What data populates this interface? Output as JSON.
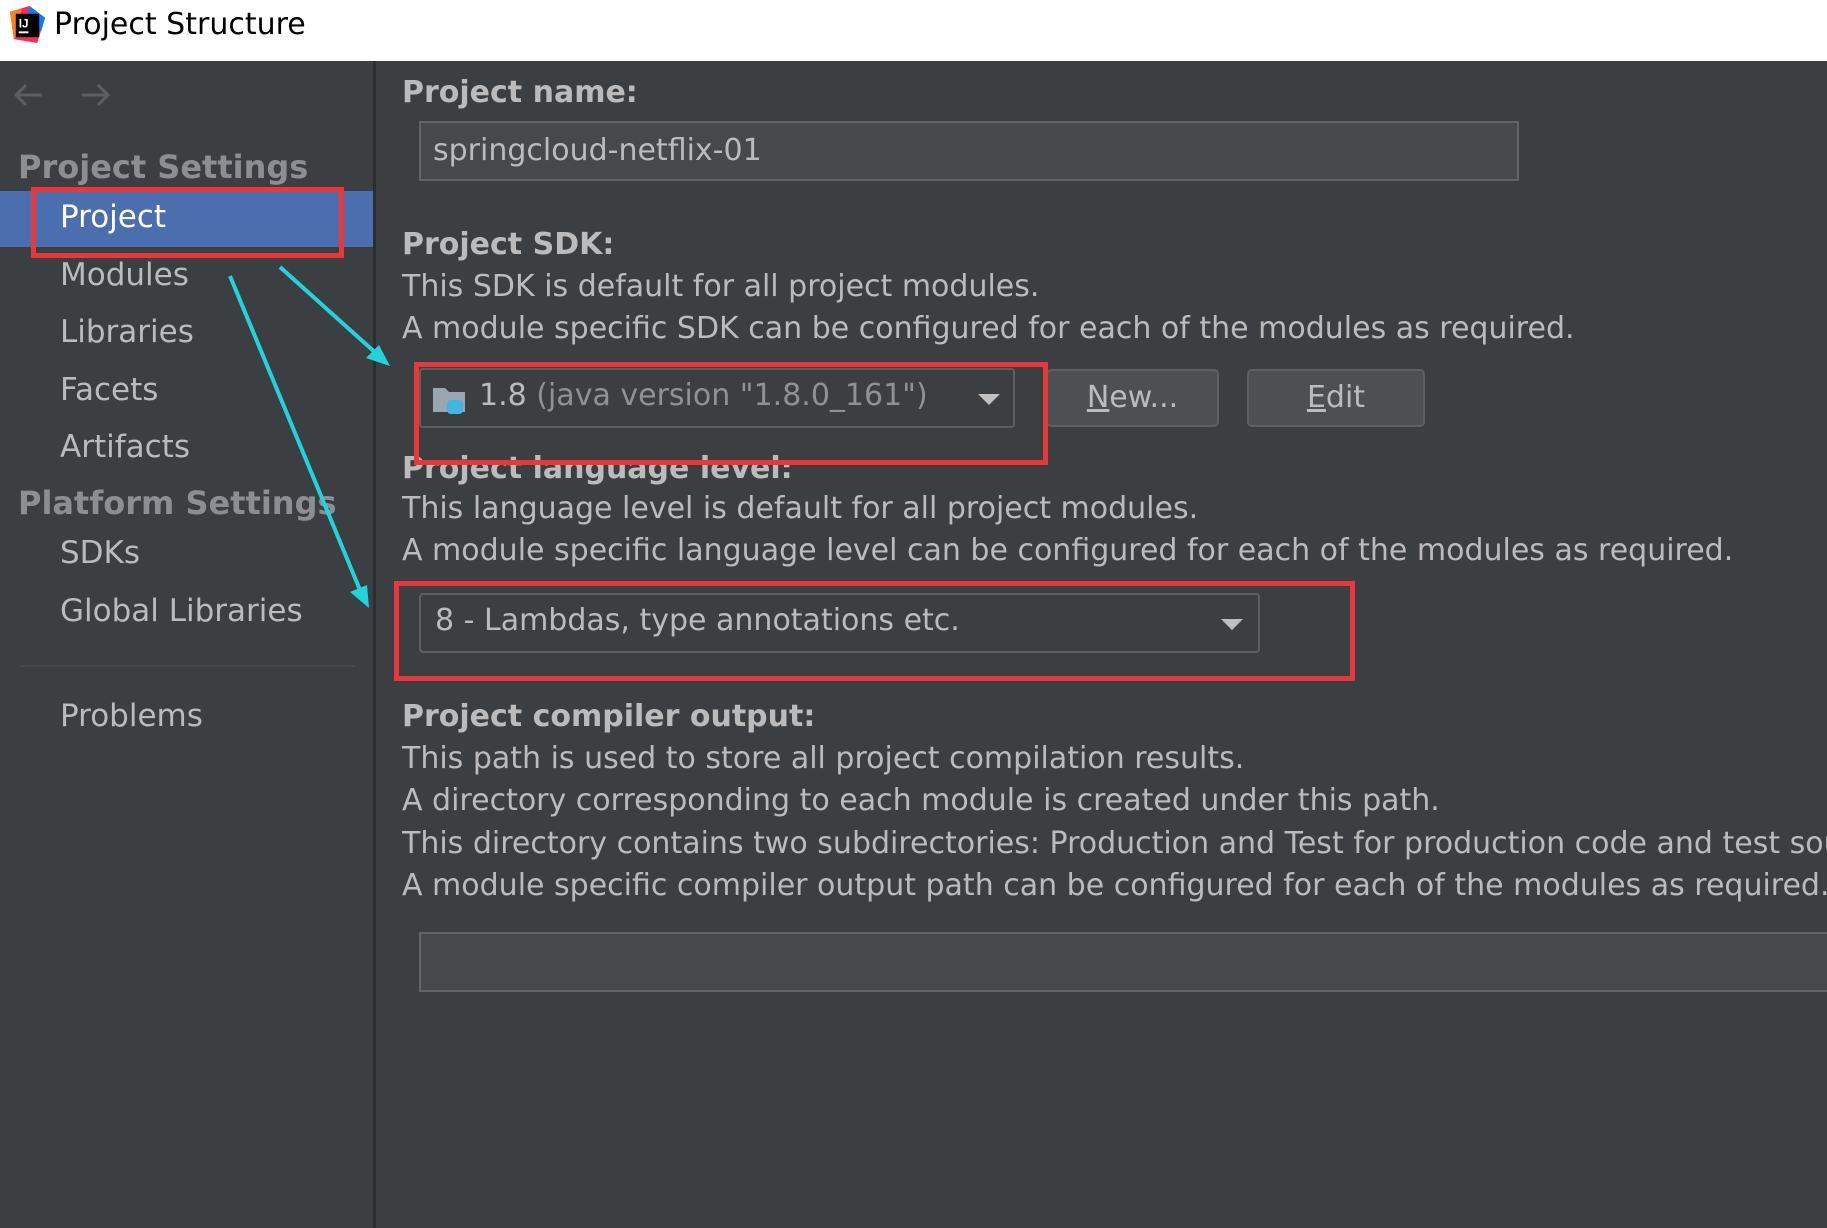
{
  "window": {
    "title": "Project Structure"
  },
  "sidebar": {
    "project_settings_title": "Project Settings",
    "project_items": [
      {
        "label": "Project",
        "selected": true
      },
      {
        "label": "Modules"
      },
      {
        "label": "Libraries"
      },
      {
        "label": "Facets"
      },
      {
        "label": "Artifacts"
      }
    ],
    "platform_settings_title": "Platform Settings",
    "platform_items": [
      {
        "label": "SDKs"
      },
      {
        "label": "Global Libraries"
      }
    ],
    "problems_label": "Problems"
  },
  "main": {
    "project_name": {
      "label": "Project name:",
      "value": "springcloud-netflix-01"
    },
    "project_sdk": {
      "label": "Project SDK:",
      "desc1": "This SDK is default for all project modules.",
      "desc2": "A module specific SDK can be configured for each of the modules as required.",
      "selected_version": "1.8",
      "selected_detail": "(java version \"1.8.0_161\")",
      "new_button": "New...",
      "edit_button": "Edit"
    },
    "language_level": {
      "label": "Project language level:",
      "desc1": "This language level is default for all project modules.",
      "desc2": "A module specific language level can be configured for each of the modules as required.",
      "selected": "8 - Lambdas, type annotations etc."
    },
    "compiler_output": {
      "label": "Project compiler output:",
      "desc1": "This path is used to store all project compilation results.",
      "desc2": "A directory corresponding to each module is created under this path.",
      "desc3": "This directory contains two subdirectories: Production and Test for production code and test sources, respectively.",
      "desc4": "A module specific compiler output path can be configured for each of the modules as required.",
      "value": ""
    }
  },
  "annotations": {
    "box_color": "#e8383b",
    "arrow_color": "#22d3dc"
  },
  "colors": {
    "selection": "#4b6eaf",
    "panel_bg": "#3c3f41"
  }
}
